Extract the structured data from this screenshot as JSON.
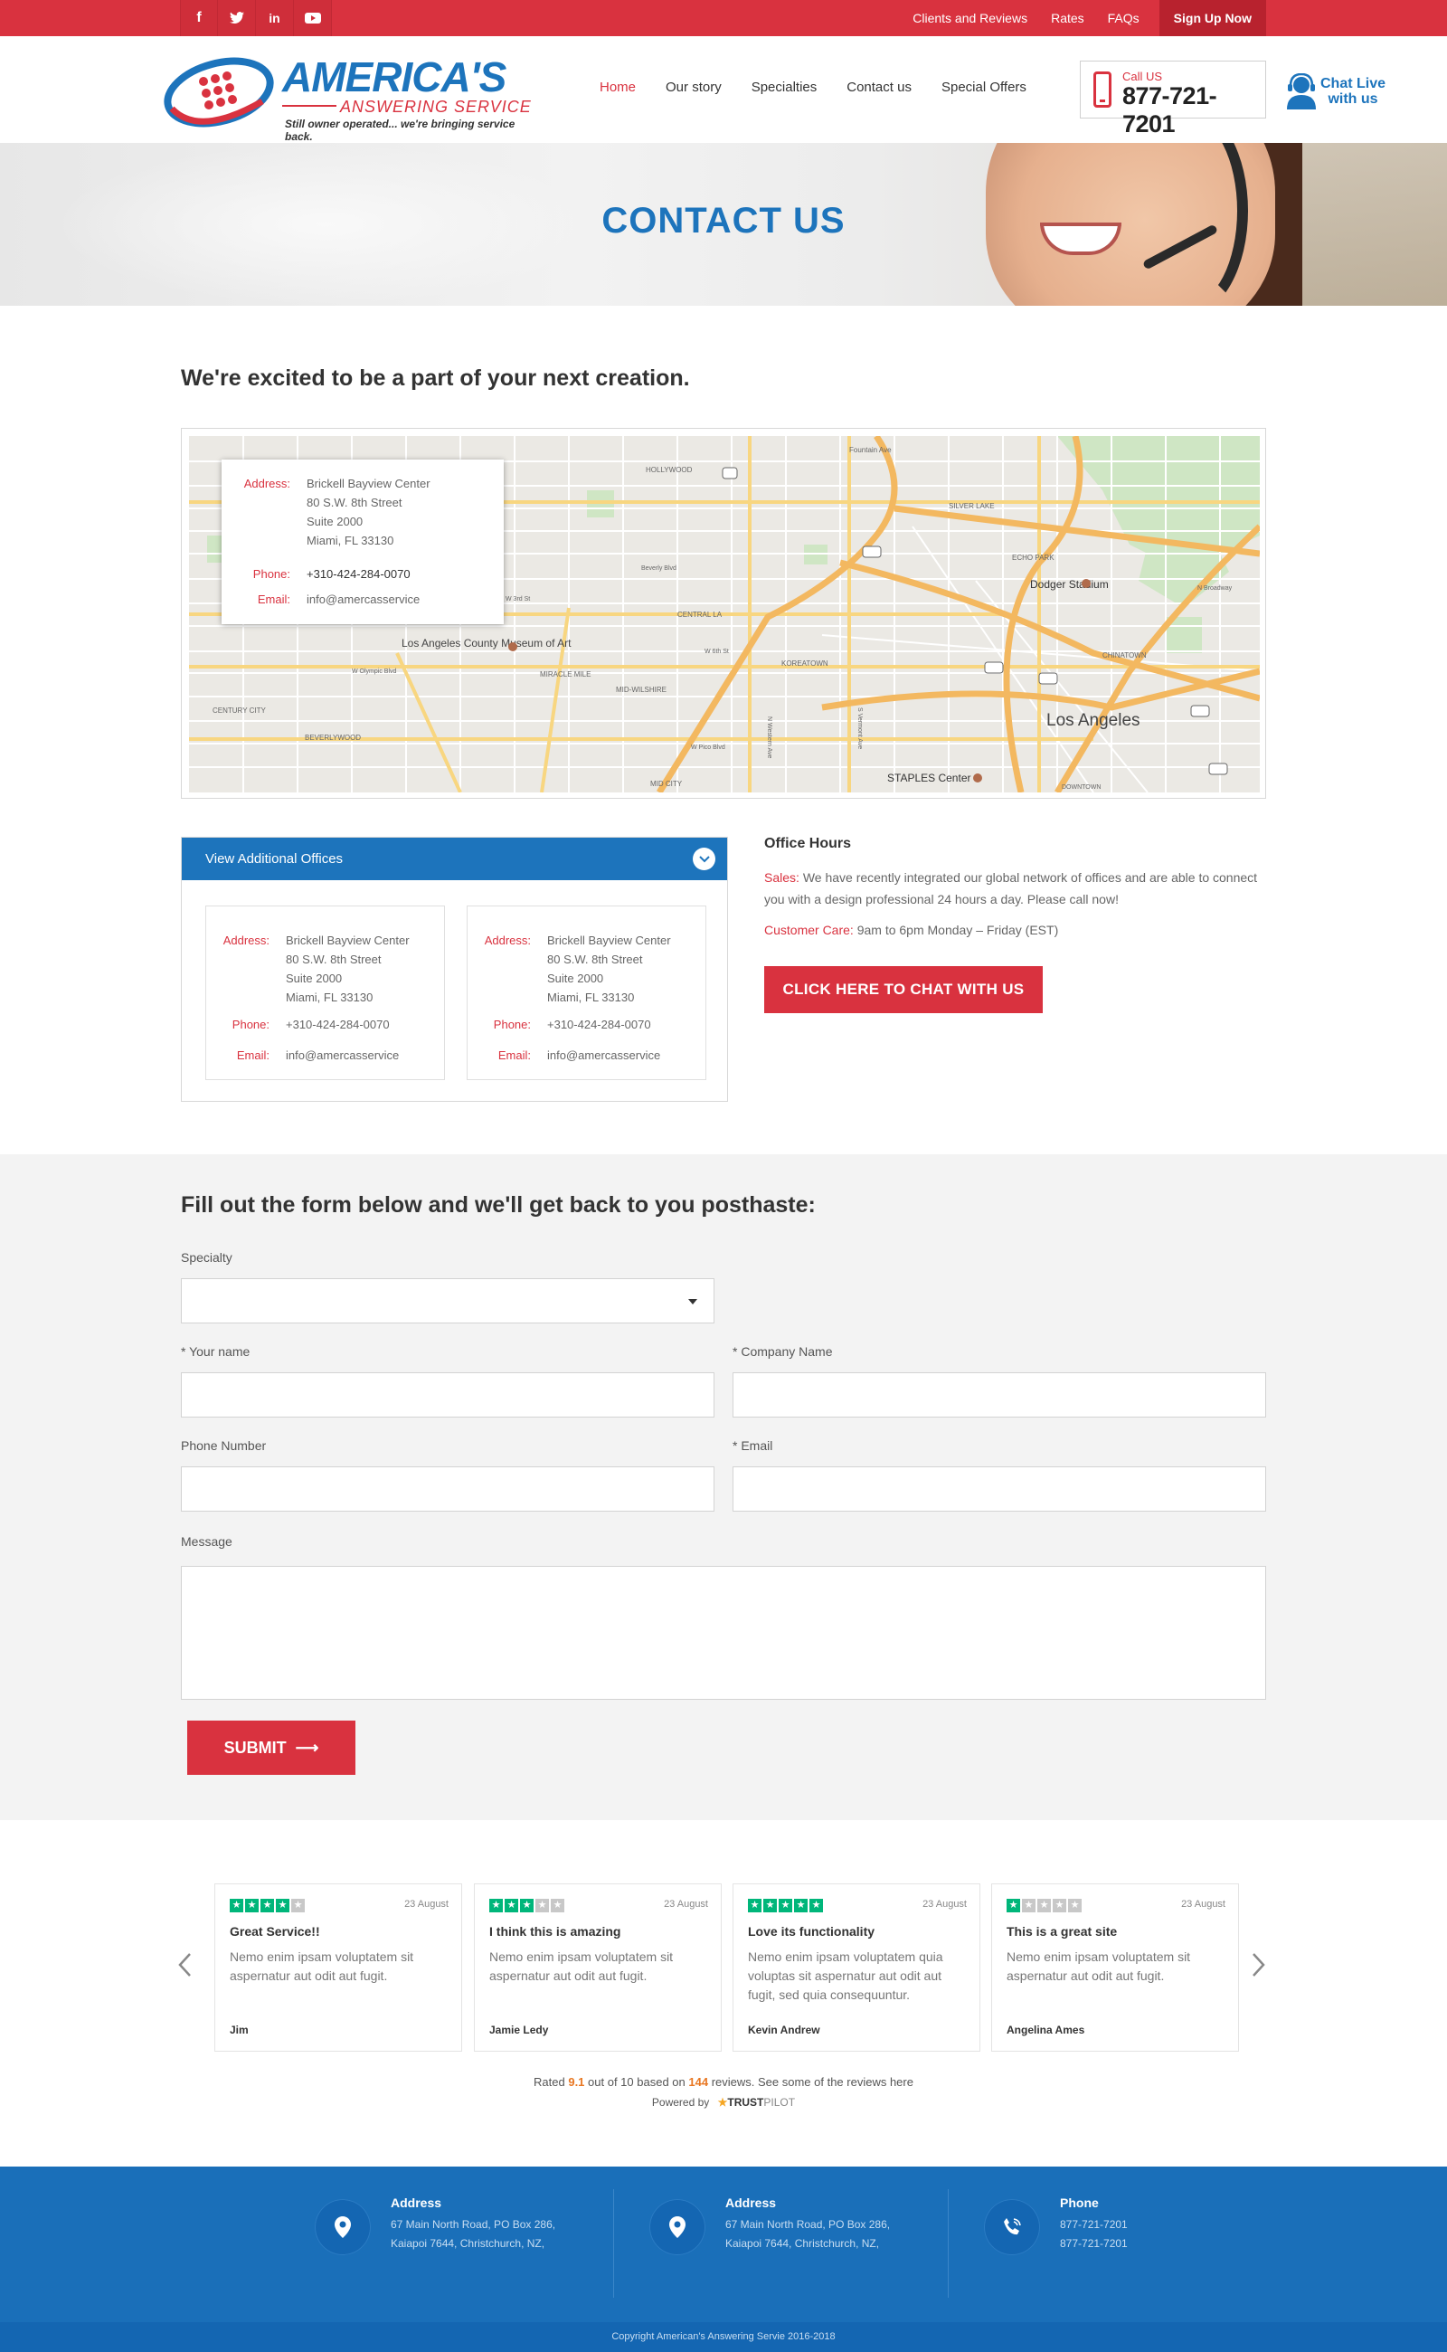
{
  "topbar": {
    "social": [
      "f",
      "t",
      "in",
      "yt"
    ],
    "links": [
      "Clients and Reviews",
      "Rates",
      "FAQs"
    ],
    "signup": "Sign Up Now"
  },
  "logo": {
    "main": "AMERICA'S",
    "sub": "ANSWERING SERVICE",
    "tagline": "Still owner operated... we're bringing service back."
  },
  "nav": [
    "Home",
    "Our story",
    "Specialties",
    "Contact us",
    "Special Offers"
  ],
  "call": {
    "label": "Call US",
    "number": "877-721-7201"
  },
  "chat": {
    "line1": "Chat Live",
    "line2": "with us"
  },
  "hero": {
    "title": "CONTACT US"
  },
  "intro": "We're excited to be a part of your next creation.",
  "map": {
    "labels": [
      "HOLLYWOOD",
      "SILVER LAKE",
      "ECHO PARK",
      "Dodger Stadium",
      "Fountain Ave",
      "CENTRAL LA",
      "KOREATOWN",
      "CHINATOWN",
      "MIRACLE MILE",
      "MID-WILSHIRE",
      "Los Angeles County Museum of Art",
      "CENTURY CITY",
      "BEVERLYWOOD",
      "MID CITY",
      "Los Angeles",
      "STAPLES Center",
      "DOWNTOWN",
      "W 3rd St",
      "W 6th St",
      "W Olympic Blvd",
      "W Pico Blvd",
      "N Western Ave",
      "S Vermont Ave",
      "Beverly Blvd",
      "N Broadway"
    ],
    "info": {
      "address_label": "Address:",
      "address_lines": [
        "Brickell Bayview Center",
        "80 S.W. 8th Street",
        "Suite 2000",
        "Miami, FL 33130"
      ],
      "phone_label": "Phone:",
      "phone": "+310-424-284-0070",
      "email_label": "Email:",
      "email": "info@amercasservice"
    }
  },
  "offices": {
    "header": "View Additional Offices",
    "cards": [
      {
        "address_label": "Address:",
        "address_lines": [
          "Brickell Bayview Center",
          "80 S.W. 8th Street",
          "Suite 2000",
          "Miami, FL 33130"
        ],
        "phone_label": "Phone:",
        "phone": "+310-424-284-0070",
        "email_label": "Email:",
        "email": "info@amercasservice"
      },
      {
        "address_label": "Address:",
        "address_lines": [
          "Brickell Bayview Center",
          "80 S.W. 8th Street",
          "Suite 2000",
          "Miami, FL 33130"
        ],
        "phone_label": "Phone:",
        "phone": "+310-424-284-0070",
        "email_label": "Email:",
        "email": "info@amercasservice"
      }
    ]
  },
  "hours": {
    "title": "Office Hours",
    "sales_label": "Sales:",
    "sales_text": "We have recently integrated our global network of offices and are able to connect you with a design professional 24 hours a day.  Please call now!",
    "care_label": "Customer Care:",
    "care_text": "9am to 6pm Monday – Friday (EST)",
    "chat_button": "CLICK HERE TO CHAT WITH US"
  },
  "form": {
    "title": "Fill out the form below and we'll get back to you posthaste:",
    "specialty_label": "Specialty",
    "specialty_value": "",
    "name_label": "* Your name",
    "company_label": "* Company Name",
    "phone_label": "Phone Number",
    "email_label": "* Email",
    "message_label": "Message",
    "submit": "SUBMIT",
    "submit_arrow": "⟶"
  },
  "reviews": [
    {
      "stars": 4,
      "date": "23 August",
      "title": "Great Service!!",
      "body": "Nemo enim ipsam voluptatem sit aspernatur aut odit aut fugit.",
      "author": "Jim"
    },
    {
      "stars": 3,
      "date": "23 August",
      "title": "I think this is amazing",
      "body": "Nemo enim ipsam voluptatem sit aspernatur aut odit aut fugit.",
      "author": "Jamie Ledy"
    },
    {
      "stars": 5,
      "date": "23 August",
      "title": "Love its functionality",
      "body": "Nemo enim ipsam voluptatem quia voluptas sit aspernatur aut odit aut fugit, sed quia consequuntur.",
      "author": "Kevin Andrew"
    },
    {
      "stars": 1,
      "date": "23 August",
      "title": "This is a great site",
      "body": "Nemo enim ipsam voluptatem sit aspernatur aut odit aut fugit.",
      "author": "Angelina Ames"
    }
  ],
  "rating": {
    "prefix": "Rated",
    "score": "9.1",
    "middle": "out of 10 based on",
    "count": "144",
    "suffix": "reviews. See some of the reviews here",
    "powered": "Powered by",
    "trust": "TRUST",
    "pilot": "PILOT"
  },
  "footer": {
    "columns": [
      {
        "title": "Address",
        "lines": [
          "67 Main North Road, PO Box 286,",
          "Kaiapoi 7644,  Christchurch, NZ,"
        ]
      },
      {
        "title": "Address",
        "lines": [
          "67 Main North Road, PO Box 286,",
          "Kaiapoi 7644,  Christchurch, NZ,"
        ]
      },
      {
        "title": "Phone",
        "lines": [
          "877-721-7201",
          "877-721-7201"
        ]
      }
    ],
    "copyright": "Copyright American's Answering Servie 2016-2018"
  },
  "colors": {
    "brand_red": "#d9323f",
    "brand_blue": "#1d74bc",
    "footer_blue": "#1a6fb9",
    "trust_green": "#00b67a"
  },
  "icons": [
    "facebook-icon",
    "twitter-icon",
    "linkedin-icon",
    "youtube-icon",
    "mobile-phone-icon",
    "chat-agent-icon",
    "chevron-down-icon",
    "map-pin-icon",
    "phone-ring-icon",
    "chevron-left-icon",
    "chevron-right-icon",
    "star-icon"
  ]
}
